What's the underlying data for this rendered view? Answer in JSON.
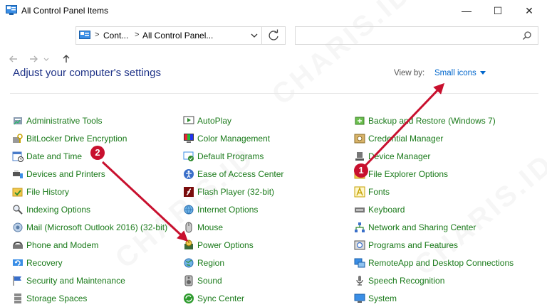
{
  "window": {
    "title": "All Control Panel Items",
    "minimize": "—",
    "maximize": "☐",
    "close": "✕"
  },
  "address": {
    "crumbs": [
      "Cont...",
      "All Control Panel..."
    ],
    "search_placeholder": ""
  },
  "heading": "Adjust your computer's settings",
  "view_by": {
    "label": "View by:",
    "value": "Small icons"
  },
  "columns": [
    {
      "items": [
        {
          "label": "Administrative Tools",
          "icon": "admin-tools-icon"
        },
        {
          "label": "BitLocker Drive Encryption",
          "icon": "bitlocker-icon"
        },
        {
          "label": "Date and Time",
          "icon": "date-time-icon"
        },
        {
          "label": "Devices and Printers",
          "icon": "devices-printers-icon"
        },
        {
          "label": "File History",
          "icon": "file-history-icon"
        },
        {
          "label": "Indexing Options",
          "icon": "indexing-icon"
        },
        {
          "label": "Mail (Microsoft Outlook 2016) (32-bit)",
          "icon": "mail-icon"
        },
        {
          "label": "Phone and Modem",
          "icon": "phone-modem-icon"
        },
        {
          "label": "Recovery",
          "icon": "recovery-icon"
        },
        {
          "label": "Security and Maintenance",
          "icon": "security-flag-icon"
        },
        {
          "label": "Storage Spaces",
          "icon": "storage-spaces-icon"
        }
      ]
    },
    {
      "items": [
        {
          "label": "AutoPlay",
          "icon": "autoplay-icon"
        },
        {
          "label": "Color Management",
          "icon": "color-management-icon"
        },
        {
          "label": "Default Programs",
          "icon": "default-programs-icon"
        },
        {
          "label": "Ease of Access Center",
          "icon": "ease-of-access-icon"
        },
        {
          "label": "Flash Player (32-bit)",
          "icon": "flash-player-icon"
        },
        {
          "label": "Internet Options",
          "icon": "internet-options-icon"
        },
        {
          "label": "Mouse",
          "icon": "mouse-icon"
        },
        {
          "label": "Power Options",
          "icon": "power-options-icon"
        },
        {
          "label": "Region",
          "icon": "region-icon"
        },
        {
          "label": "Sound",
          "icon": "sound-icon"
        },
        {
          "label": "Sync Center",
          "icon": "sync-center-icon"
        }
      ]
    },
    {
      "items": [
        {
          "label": "Backup and Restore (Windows 7)",
          "icon": "backup-restore-icon"
        },
        {
          "label": "Credential Manager",
          "icon": "credential-manager-icon"
        },
        {
          "label": "Device Manager",
          "icon": "device-manager-icon"
        },
        {
          "label": "File Explorer Options",
          "icon": "folder-options-icon"
        },
        {
          "label": "Fonts",
          "icon": "fonts-icon"
        },
        {
          "label": "Keyboard",
          "icon": "keyboard-icon"
        },
        {
          "label": "Network and Sharing Center",
          "icon": "network-icon"
        },
        {
          "label": "Programs and Features",
          "icon": "programs-features-icon"
        },
        {
          "label": "RemoteApp and Desktop Connections",
          "icon": "remoteapp-icon"
        },
        {
          "label": "Speech Recognition",
          "icon": "speech-icon"
        },
        {
          "label": "System",
          "icon": "system-icon"
        }
      ]
    }
  ],
  "annotations": {
    "badge_1": "1",
    "badge_2": "2"
  },
  "watermark": "CHARIS.ID",
  "colors": {
    "link_green": "#1a7a1a",
    "heading_blue": "#1e3287",
    "accent_blue": "#0066cc",
    "annotation_red": "#c8102e"
  }
}
